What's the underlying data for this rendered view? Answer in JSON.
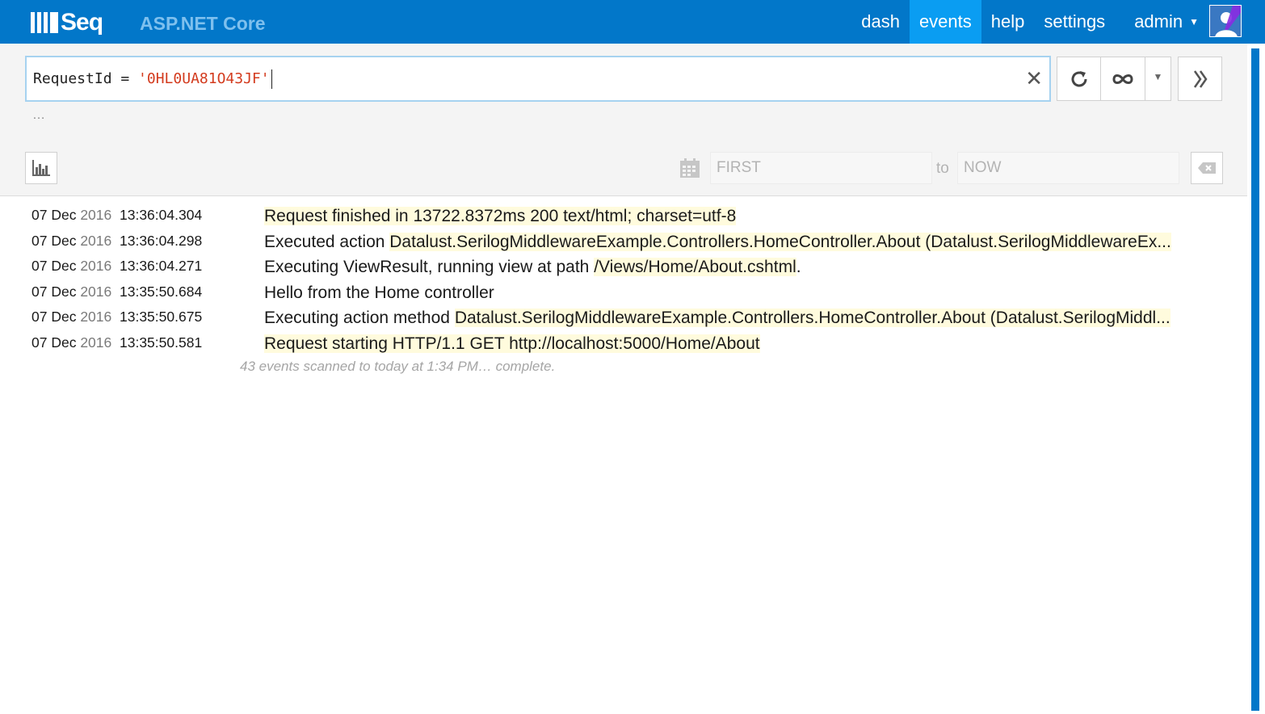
{
  "header": {
    "logo_text": "Seq",
    "app_title": "ASP.NET Core",
    "nav": [
      {
        "label": "dash"
      },
      {
        "label": "events"
      },
      {
        "label": "help"
      },
      {
        "label": "settings"
      }
    ],
    "user": "admin",
    "colors": {
      "bar": "#0277c9",
      "active": "#0a9df2"
    }
  },
  "search": {
    "query_prefix": "RequestId = ",
    "query_value": "'0HL0UA81O43JF'",
    "clear_glyph": "✕",
    "ellipsis": "…"
  },
  "toolbar": {
    "refresh_icon": "refresh-icon",
    "tail_icon": "infinity-icon",
    "dropdown_glyph": "▼",
    "expand_icon": "double-chevron-right-icon"
  },
  "range": {
    "from_placeholder": "FIRST",
    "to_label": "to",
    "to_placeholder": "NOW"
  },
  "events": [
    {
      "day": "07 Dec",
      "year": "2016",
      "time": "13:36:04.304",
      "parts": [
        {
          "text": "Request finished in 13722.8372ms 200 text/html; charset=utf-8",
          "hl": true
        }
      ]
    },
    {
      "day": "07 Dec",
      "year": "2016",
      "time": "13:36:04.298",
      "parts": [
        {
          "text": "Executed action ",
          "hl": false
        },
        {
          "text": "Datalust.SerilogMiddlewareExample.Controllers.HomeController.About (Datalust.SerilogMiddlewareEx...",
          "hl": true
        }
      ]
    },
    {
      "day": "07 Dec",
      "year": "2016",
      "time": "13:36:04.271",
      "parts": [
        {
          "text": "Executing ViewResult, running view at path ",
          "hl": false
        },
        {
          "text": "/Views/Home/About.cshtml",
          "hl": true
        },
        {
          "text": ".",
          "hl": false
        }
      ]
    },
    {
      "day": "07 Dec",
      "year": "2016",
      "time": "13:35:50.684",
      "parts": [
        {
          "text": "Hello from the Home controller",
          "hl": false
        }
      ]
    },
    {
      "day": "07 Dec",
      "year": "2016",
      "time": "13:35:50.675",
      "parts": [
        {
          "text": "Executing action method ",
          "hl": false
        },
        {
          "text": "Datalust.SerilogMiddlewareExample.Controllers.HomeController.About (Datalust.SerilogMiddl...",
          "hl": true
        }
      ]
    },
    {
      "day": "07 Dec",
      "year": "2016",
      "time": "13:35:50.581",
      "parts": [
        {
          "text": "Request starting HTTP/1.1 GET http://localhost:5000/Home/About",
          "hl": true
        }
      ]
    }
  ],
  "status": "43 events scanned to today at 1:34 PM… complete."
}
